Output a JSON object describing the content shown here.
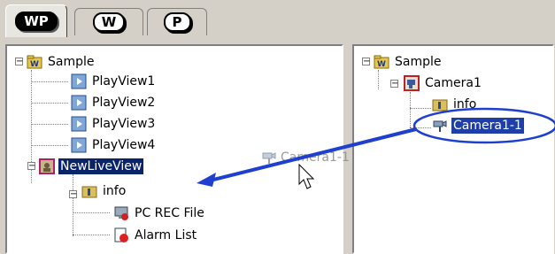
{
  "tabs": [
    {
      "label": "WP",
      "active": true
    },
    {
      "label": "W",
      "active": false
    },
    {
      "label": "P",
      "active": false
    }
  ],
  "left_tree": {
    "root": "Sample",
    "items": [
      "PlayView1",
      "PlayView2",
      "PlayView3",
      "PlayView4"
    ],
    "live_view": "NewLiveView",
    "info": "info",
    "info_children": [
      "PC REC File",
      "Alarm List"
    ]
  },
  "right_tree": {
    "root": "Sample",
    "camera": "Camera1",
    "info": "info",
    "camera_child": "Camera1-1"
  },
  "drag_ghost_label": "Camera1-1",
  "colors": {
    "selection": "#0a246a",
    "arrow": "#1e3fd0",
    "highlight_ellipse": "#1e3fd0"
  }
}
